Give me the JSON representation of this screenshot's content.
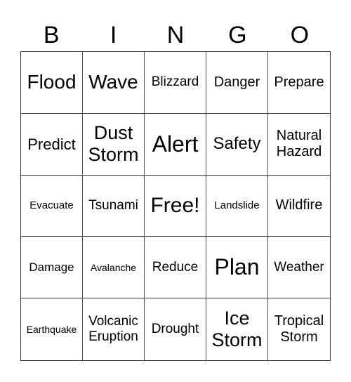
{
  "header": [
    "B",
    "I",
    "N",
    "G",
    "O"
  ],
  "cells": [
    "Flood",
    "Wave",
    "Blizzard",
    "Danger",
    "Prepare",
    "Predict",
    "Dust Storm",
    "Alert",
    "Safety",
    "Natural Hazard",
    "Evacuate",
    "Tsunami",
    "Free!",
    "Landslide",
    "Wildfire",
    "Damage",
    "Avalanche",
    "Reduce",
    "Plan",
    "Weather",
    "Earthquake",
    "Volcanic Eruption",
    "Drought",
    "Ice Storm",
    "Tropical Storm"
  ]
}
